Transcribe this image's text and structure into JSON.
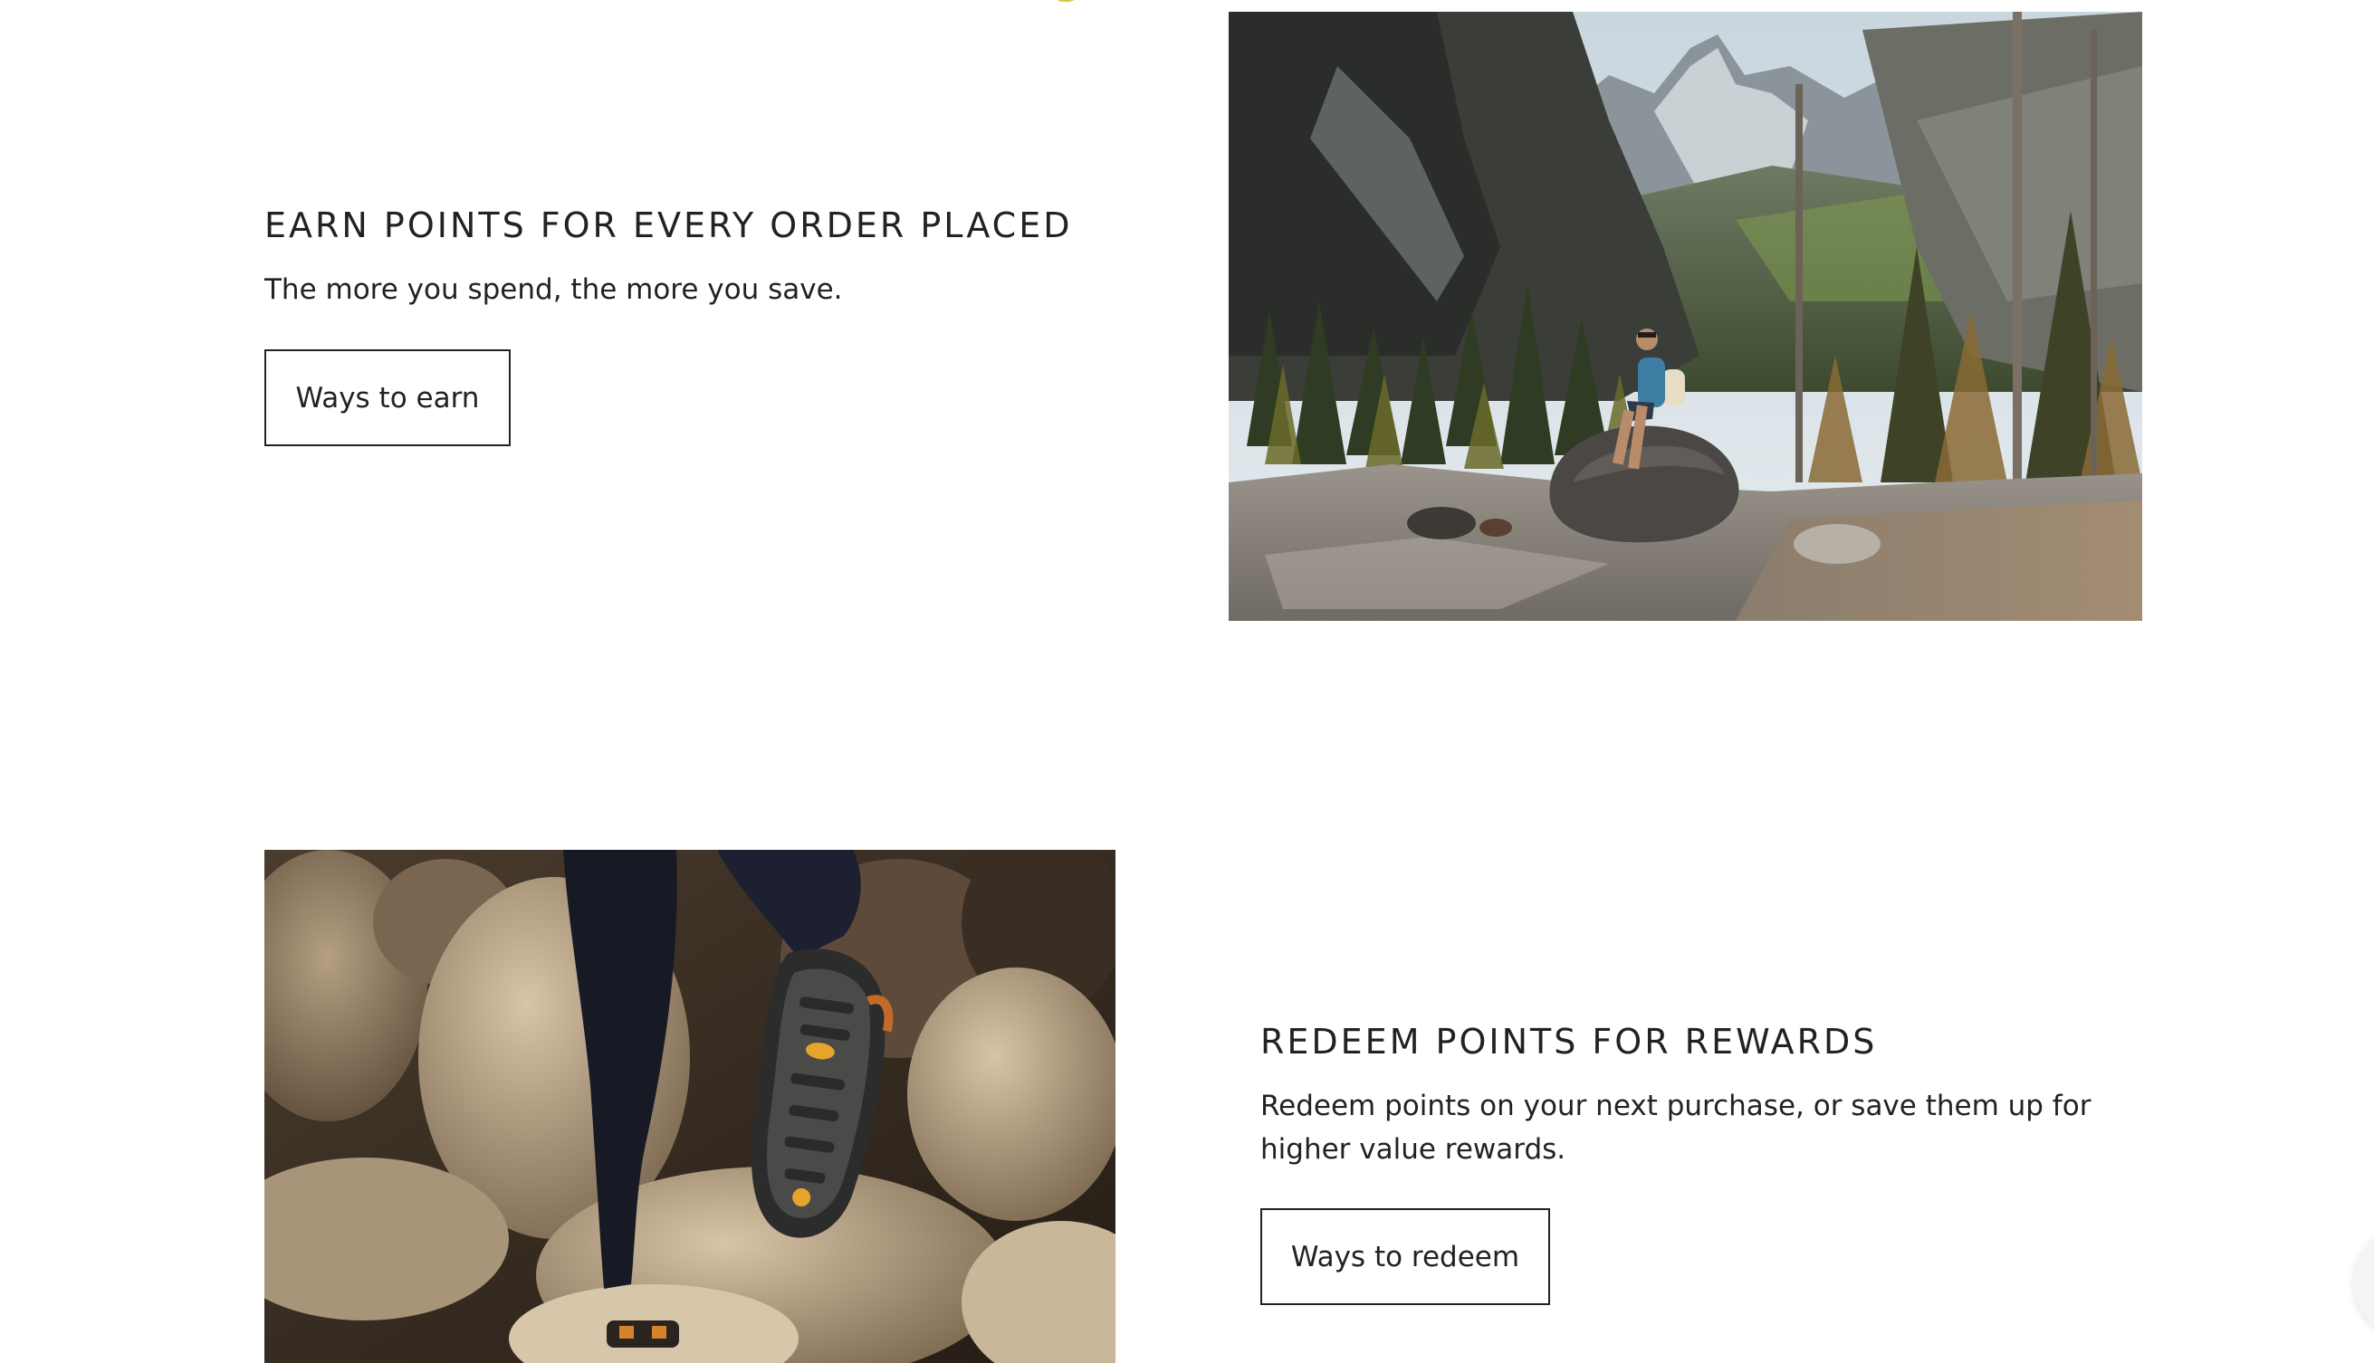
{
  "earn": {
    "heading": "EARN POINTS FOR EVERY ORDER PLACED",
    "body": "The more you spend, the more you save.",
    "button_label": "Ways to earn"
  },
  "redeem": {
    "heading": "REDEEM POINTS FOR REWARDS",
    "body_line1": "Redeem points on your next purchase, or save them up for",
    "body_line2": "higher value rewards.",
    "button_label": "Ways to redeem"
  },
  "images": {
    "mountain": "hiker-sitting-on-boulder-mountain-valley",
    "feet": "hiker-sandal-sole-stepping-on-rocks"
  },
  "colors": {
    "text": "#222222",
    "border": "#222222",
    "background": "#ffffff"
  }
}
